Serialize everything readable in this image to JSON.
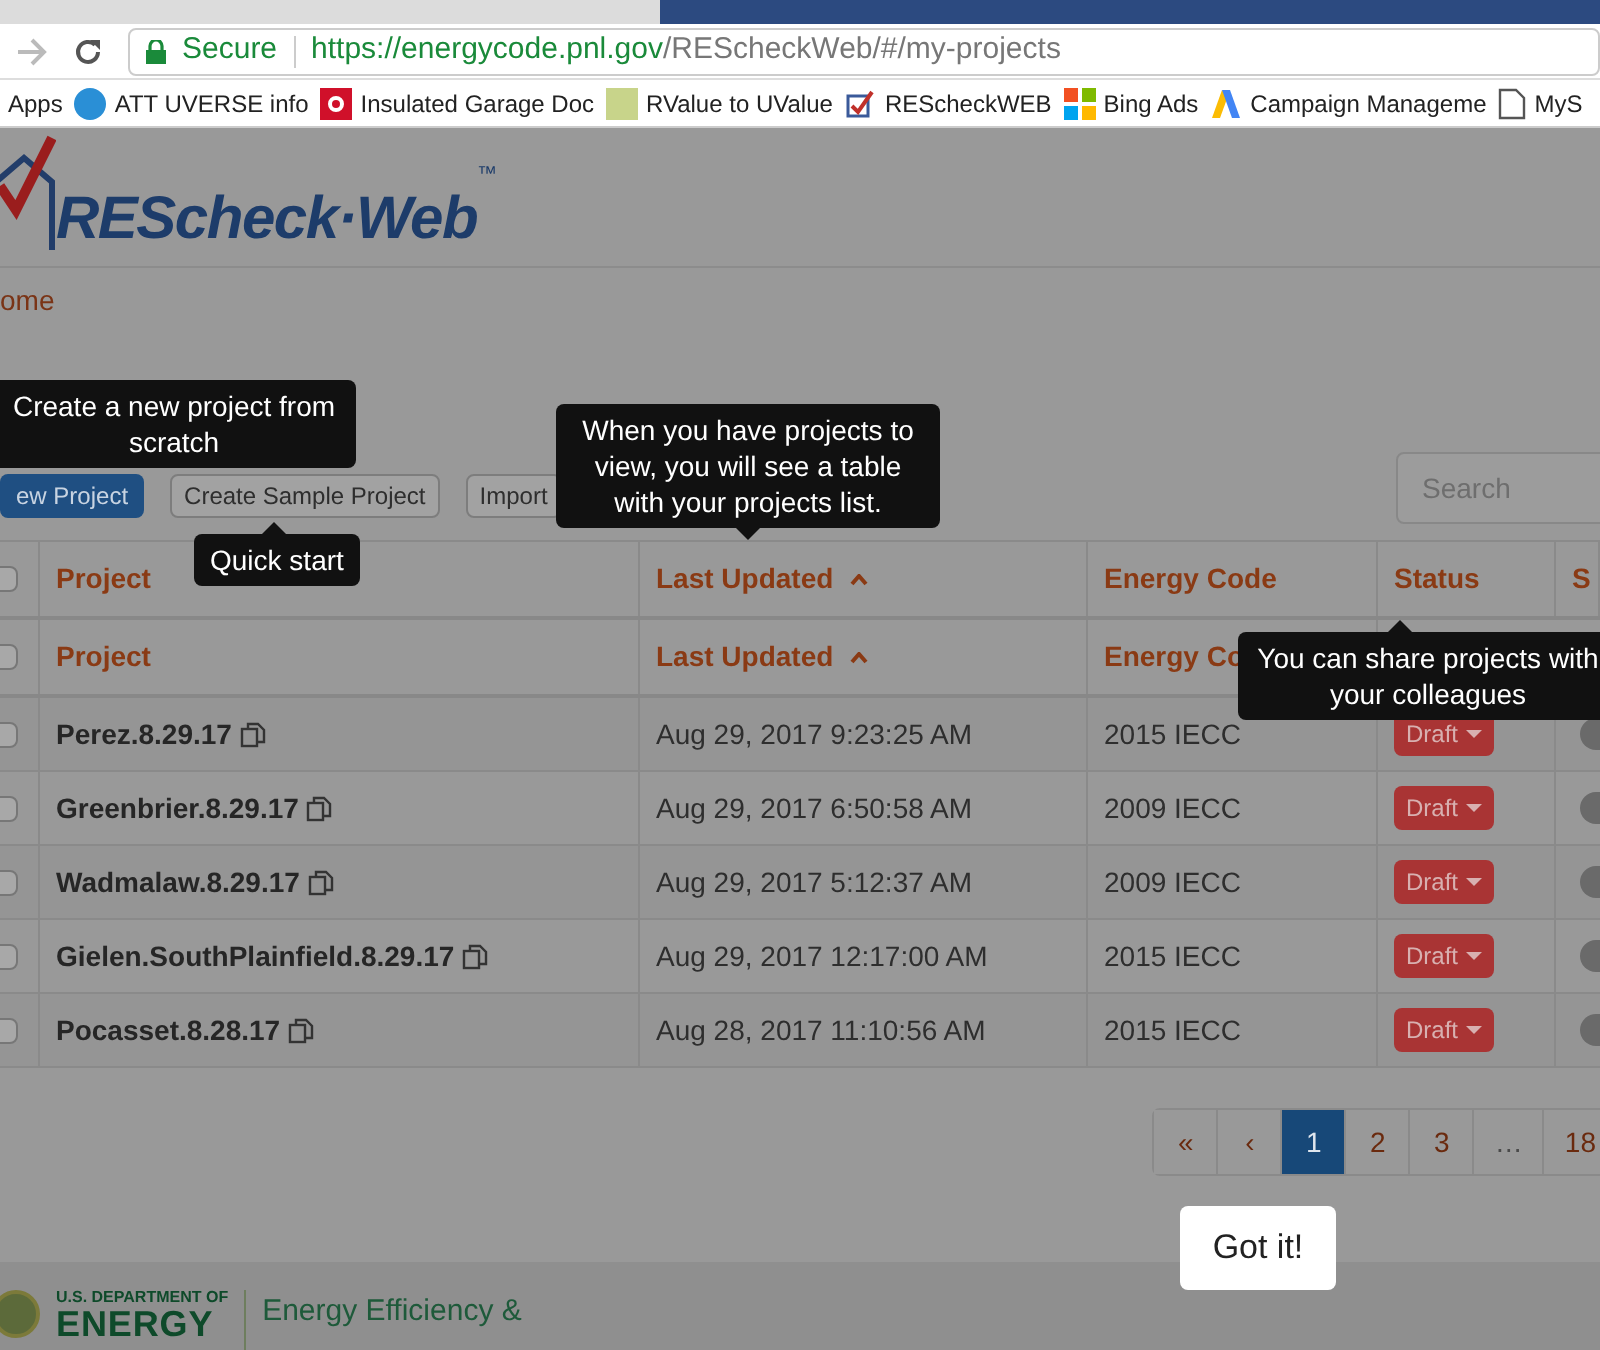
{
  "browser": {
    "secure_label": "Secure",
    "url_host": "https://energycode.pnl.gov",
    "url_path": "/REScheckWeb/#/my-projects",
    "bookmarks": [
      {
        "label": "Apps"
      },
      {
        "label": "ATT UVERSE info"
      },
      {
        "label": "Insulated Garage Doc"
      },
      {
        "label": "RValue to UValue"
      },
      {
        "label": "REScheckWEB"
      },
      {
        "label": "Bing Ads"
      },
      {
        "label": "Campaign Manageme"
      },
      {
        "label": "MyS"
      }
    ]
  },
  "logo": {
    "text": "REScheck·Web",
    "mark": "™"
  },
  "breadcrumb": "ome",
  "actions": [
    {
      "label": "ew Project",
      "kind": "primary"
    },
    {
      "label": "Create Sample Project",
      "kind": "default"
    },
    {
      "label": "Import",
      "kind": "default"
    }
  ],
  "search": {
    "placeholder": "Search"
  },
  "table": {
    "columns": [
      {
        "label": "Project",
        "sorted": false
      },
      {
        "label": "Last Updated",
        "sorted": true
      },
      {
        "label": "Energy Code",
        "sorted": false
      },
      {
        "label": "Status",
        "sorted": false
      },
      {
        "label": "S",
        "sorted": false
      }
    ],
    "header_checked": false,
    "sticky_checked": false,
    "sticky_header": [
      {
        "label": "Project",
        "sorted": false
      },
      {
        "label": "Last Updated",
        "sorted": true
      },
      {
        "label": "Energy Co",
        "sorted": false
      }
    ],
    "rows": [
      {
        "project": "Perez.8.29.17",
        "updated": "Aug 29, 2017 9:23:25 AM",
        "code": "2015 IECC",
        "status": "Draft",
        "checked": false
      },
      {
        "project": "Greenbrier.8.29.17",
        "updated": "Aug 29, 2017 6:50:58 AM",
        "code": "2009 IECC",
        "status": "Draft",
        "checked": false
      },
      {
        "project": "Wadmalaw.8.29.17",
        "updated": "Aug 29, 2017 5:12:37 AM",
        "code": "2009 IECC",
        "status": "Draft",
        "checked": false
      },
      {
        "project": "Gielen.SouthPlainfield.8.29.17",
        "updated": "Aug 29, 2017 12:17:00 AM",
        "code": "2015 IECC",
        "status": "Draft",
        "checked": false
      },
      {
        "project": "Pocasset.8.28.17",
        "updated": "Aug 28, 2017 11:10:56 AM",
        "code": "2015 IECC",
        "status": "Draft",
        "checked": false
      }
    ]
  },
  "pagination": [
    {
      "label": "«",
      "selected": false
    },
    {
      "label": "‹",
      "selected": false
    },
    {
      "label": "1",
      "selected": true
    },
    {
      "label": "2",
      "selected": false
    },
    {
      "label": "3",
      "selected": false
    },
    {
      "label": "…",
      "selected": false
    },
    {
      "label": "18",
      "selected": false
    }
  ],
  "tooltips": [
    {
      "text": "Create a new project from scratch"
    },
    {
      "text": "When you have projects to view, you will see a table with your projects list."
    },
    {
      "text": "Quick start"
    },
    {
      "text": "You can share projects with your colleagues"
    }
  ],
  "got_it": "Got it!",
  "footer": {
    "dept_small": "U.S. DEPARTMENT OF",
    "dept_big": "ENERGY",
    "office": "Energy Efficiency &"
  }
}
